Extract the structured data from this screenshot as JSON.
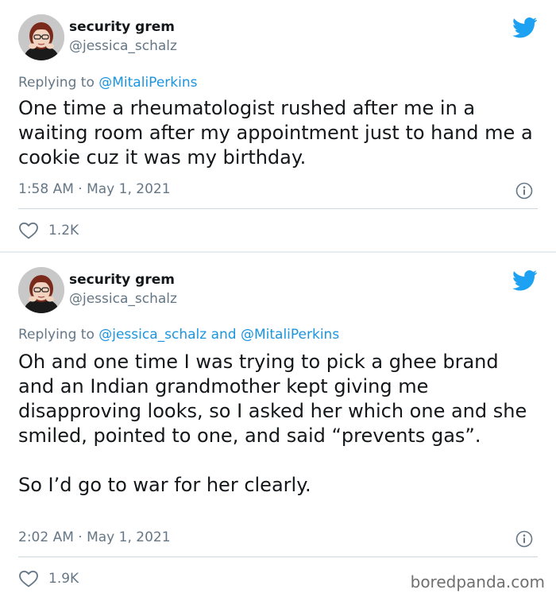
{
  "colors": {
    "link": "#1b95e0",
    "muted": "#657786",
    "text": "#14171a",
    "bird": "#1da1f2"
  },
  "tweets": [
    {
      "name": "security grem",
      "handle": "@jessica_schalz",
      "replying_prefix": "Replying to ",
      "replying_mentions": "@MitaliPerkins",
      "text": "One time a rheumatologist rushed after me in a waiting room after my appointment just to hand me a cookie cuz it was my birthday.",
      "timestamp": "1:58 AM · May 1, 2021",
      "likes": "1.2K",
      "icons": {
        "bird": "twitter-bird-icon",
        "info": "info-icon",
        "like": "heart-icon"
      }
    },
    {
      "name": "security grem",
      "handle": "@jessica_schalz",
      "replying_prefix": "Replying to ",
      "replying_mentions": "@jessica_schalz and @MitaliPerkins",
      "text": "Oh and one time I was trying to pick a ghee brand and an Indian grandmother kept giving me disapproving looks, so I asked her which one and she smiled, pointed to one, and said “prevents gas”.\n\nSo I’d go to war for her clearly.",
      "timestamp": "2:02 AM · May 1, 2021",
      "likes": "1.9K",
      "icons": {
        "bird": "twitter-bird-icon",
        "info": "info-icon",
        "like": "heart-icon"
      }
    }
  ],
  "watermark": "boredpanda.com"
}
